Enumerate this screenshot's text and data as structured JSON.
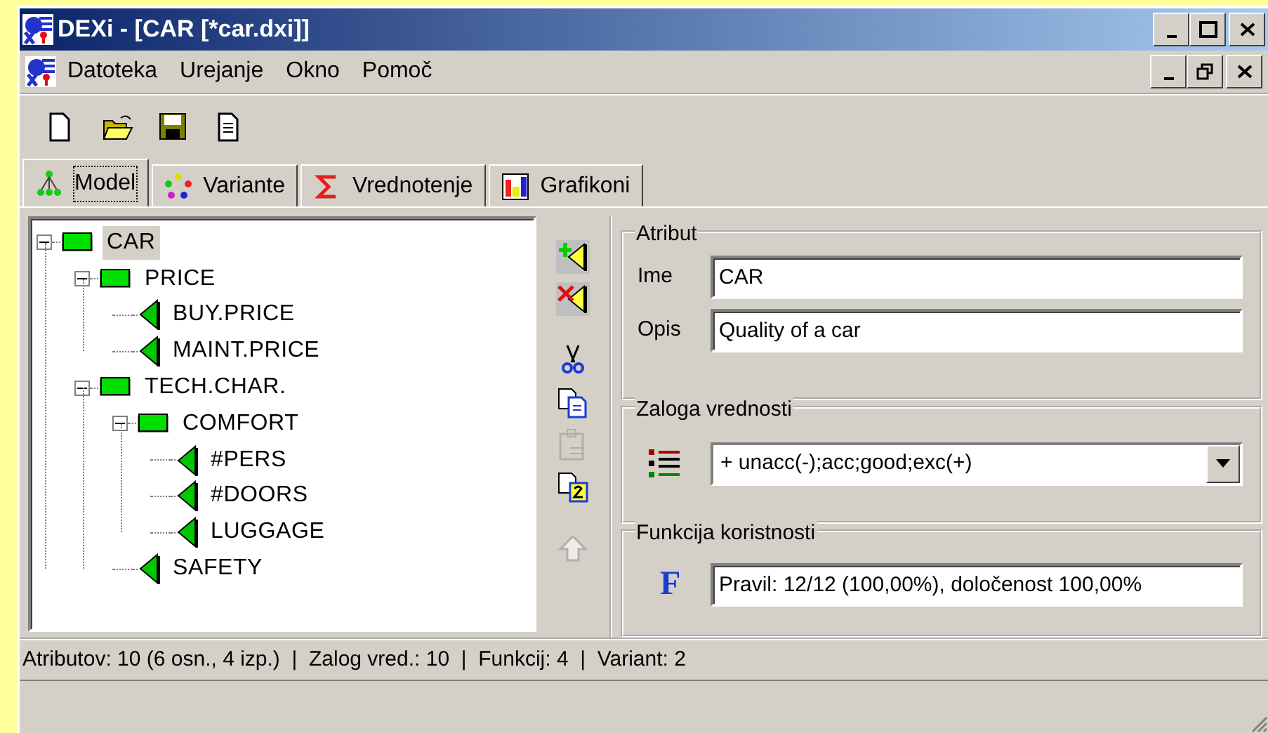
{
  "window": {
    "title": "DEXi - [CAR [*car.dxi]]"
  },
  "menu": [
    "Datoteka",
    "Urejanje",
    "Okno",
    "Pomoč"
  ],
  "tabs": [
    {
      "label": "Model",
      "selected": true,
      "kind": "model"
    },
    {
      "label": "Variante",
      "selected": false,
      "kind": "variants"
    },
    {
      "label": "Vrednotenje",
      "selected": false,
      "kind": "evaluation"
    },
    {
      "label": "Grafikoni",
      "selected": false,
      "kind": "charts"
    }
  ],
  "tree": [
    {
      "label": "CAR",
      "kind": "aggregate",
      "selected": true,
      "expanded": true,
      "children": [
        {
          "label": "PRICE",
          "kind": "aggregate",
          "selected": false,
          "expanded": true,
          "children": [
            {
              "label": "BUY.PRICE",
              "kind": "basic",
              "selected": false
            },
            {
              "label": "MAINT.PRICE",
              "kind": "basic",
              "selected": false
            }
          ]
        },
        {
          "label": "TECH.CHAR.",
          "kind": "aggregate",
          "selected": false,
          "expanded": true,
          "children": [
            {
              "label": "COMFORT",
              "kind": "aggregate",
              "selected": false,
              "expanded": true,
              "children": [
                {
                  "label": "#PERS",
                  "kind": "basic",
                  "selected": false
                },
                {
                  "label": "#DOORS",
                  "kind": "basic",
                  "selected": false
                },
                {
                  "label": "LUGGAGE",
                  "kind": "basic",
                  "selected": false
                }
              ]
            },
            {
              "label": "SAFETY",
              "kind": "basic",
              "selected": false
            }
          ]
        }
      ]
    }
  ],
  "side_tools": [
    {
      "kind": "add",
      "disabled": false
    },
    {
      "kind": "delete",
      "disabled": false
    },
    {
      "kind": "cut",
      "disabled": false
    },
    {
      "kind": "copy",
      "disabled": false
    },
    {
      "kind": "paste",
      "disabled": true
    },
    {
      "kind": "copy2",
      "disabled": false
    },
    {
      "kind": "up",
      "disabled": true
    }
  ],
  "attribute": {
    "title": "Atribut",
    "name_label": "Ime",
    "name_value": "CAR",
    "desc_label": "Opis",
    "desc_value": "Quality of a car"
  },
  "scale": {
    "title": "Zaloga vrednosti",
    "value": "+ unacc(-);acc;good;exc(+)"
  },
  "function": {
    "title": "Funkcija koristnosti",
    "icon": "F",
    "value": "Pravil: 12/12 (100,00%), določenost 100,00%"
  },
  "status_bar": "Atributov: 10 (6 osn., 4 izp.)  |  Zalog vred.: 10  |  Funkcij: 4  |  Variant: 2"
}
